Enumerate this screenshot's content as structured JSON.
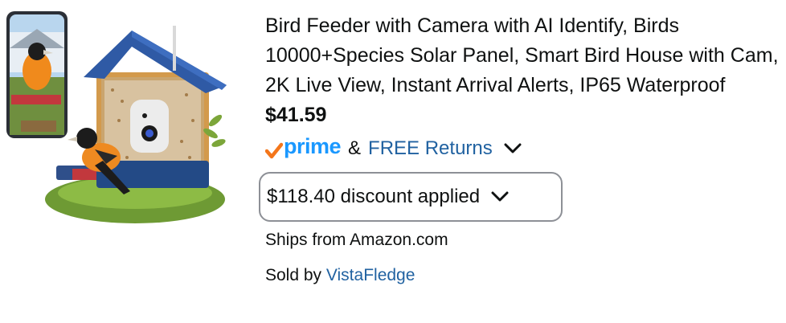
{
  "product": {
    "title": "Bird Feeder with Camera with AI Identify, Birds 10000+Species Solar Panel, Smart Bird House with Cam, 2K Live View, Instant Arrival Alerts, IP65 Waterproof",
    "price": "$41.59",
    "prime_label": "prime",
    "ampersand": "&",
    "free_returns": "FREE Returns",
    "discount_text": "$118.40 discount applied",
    "ships_from": "Ships from Amazon.com",
    "sold_by_prefix": "Sold by",
    "seller": "VistaFledge"
  },
  "icons": {
    "prime_check": "check-icon",
    "free_returns_toggle": "chevron-down-icon",
    "discount_toggle": "chevron-down-icon"
  },
  "colors": {
    "prime_blue": "#1a98ff",
    "prime_check_orange": "#f4761b",
    "link_blue": "#2162a1",
    "discount_border": "#8d9096",
    "text": "#0f1111"
  }
}
